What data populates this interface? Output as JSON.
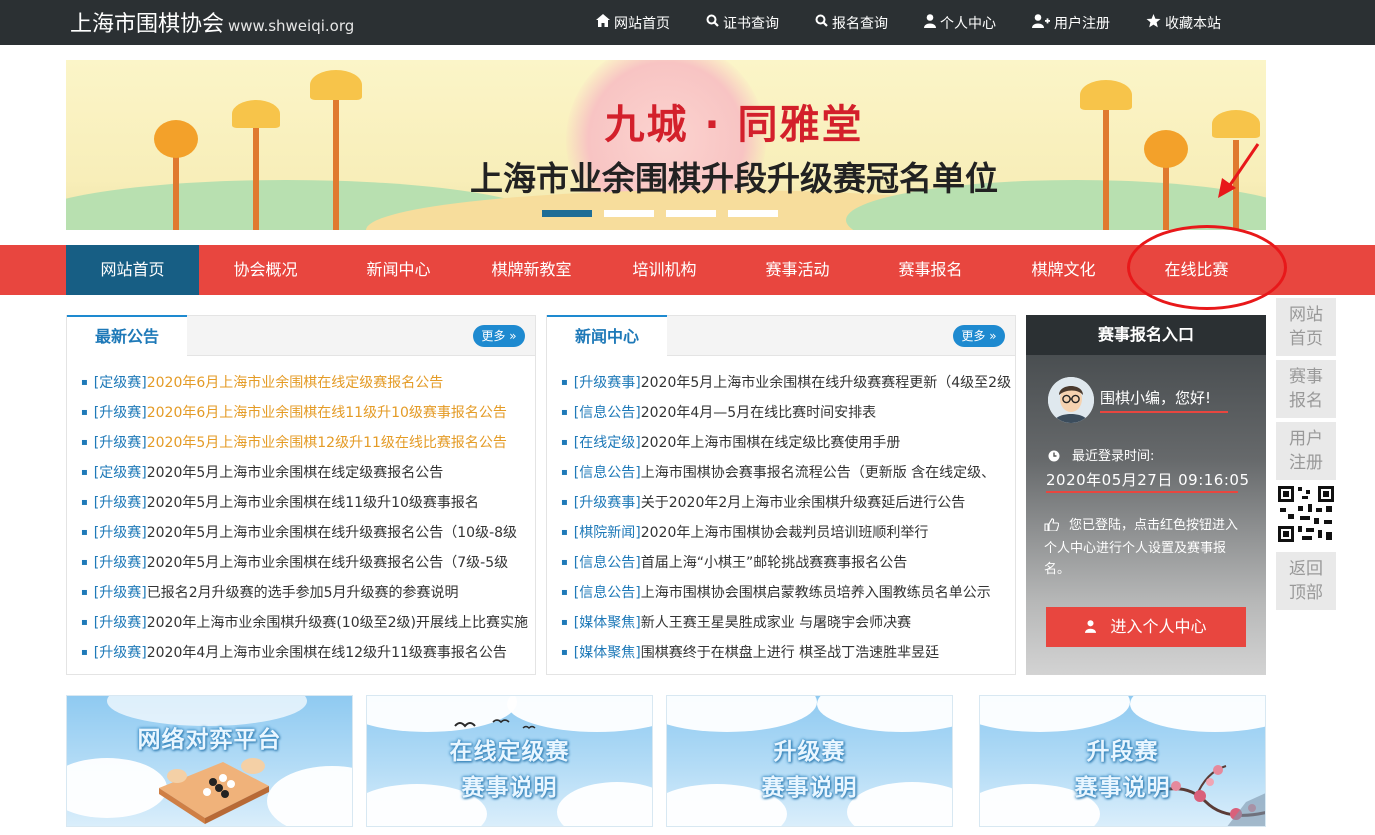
{
  "header": {
    "site_name": "上海市围棋协会",
    "site_domain": "www.shweiqi.org",
    "links": [
      {
        "label": "网站首页",
        "icon": "home-icon"
      },
      {
        "label": "证书查询",
        "icon": "search-icon"
      },
      {
        "label": "报名查询",
        "icon": "search-icon"
      },
      {
        "label": "个人中心",
        "icon": "user-icon"
      },
      {
        "label": "用户注册",
        "icon": "user-plus-icon"
      },
      {
        "label": "收藏本站",
        "icon": "star-icon"
      }
    ]
  },
  "banner": {
    "title": "九城 · 同雅堂",
    "subtitle": "上海市业余围棋升段升级赛冠名单位",
    "active_slide": 1,
    "slide_count": 4
  },
  "nav": {
    "items": [
      "网站首页",
      "协会概况",
      "新闻中心",
      "棋牌新教室",
      "培训机构",
      "赛事活动",
      "赛事报名",
      "棋牌文化",
      "在线比赛"
    ],
    "active_index": 0
  },
  "side": {
    "buttons": [
      "网站首页",
      "赛事报名",
      "用户注册",
      "返回顶部"
    ]
  },
  "announcements": {
    "tab": "最新公告",
    "more": "更多 »",
    "items": [
      {
        "cat": "[定级赛]",
        "title": "2020年6月上海市业余围棋在线定级赛报名公告",
        "highlight": true
      },
      {
        "cat": "[升级赛]",
        "title": "2020年6月上海市业余围棋在线11级升10级赛事报名公告",
        "highlight": true
      },
      {
        "cat": "[升级赛]",
        "title": "2020年5月上海市业余围棋12级升11级在线比赛报名公告",
        "highlight": true
      },
      {
        "cat": "[定级赛]",
        "title": "2020年5月上海市业余围棋在线定级赛报名公告",
        "highlight": false
      },
      {
        "cat": "[升级赛]",
        "title": "2020年5月上海市业余围棋在线11级升10级赛事报名",
        "highlight": false
      },
      {
        "cat": "[升级赛]",
        "title": "2020年5月上海市业余围棋在线升级赛报名公告（10级-8级",
        "highlight": false
      },
      {
        "cat": "[升级赛]",
        "title": "2020年5月上海市业余围棋在线升级赛报名公告（7级-5级",
        "highlight": false
      },
      {
        "cat": "[升级赛]",
        "title": "已报名2月升级赛的选手参加5月升级赛的参赛说明",
        "highlight": false
      },
      {
        "cat": "[升级赛]",
        "title": "2020年上海市业余围棋升级赛(10级至2级)开展线上比赛实施",
        "highlight": false
      },
      {
        "cat": "[升级赛]",
        "title": "2020年4月上海市业余围棋在线12级升11级赛事报名公告",
        "highlight": false
      }
    ]
  },
  "news": {
    "tab": "新闻中心",
    "more": "更多 »",
    "items": [
      {
        "cat": "[升级赛事]",
        "title": "2020年5月上海市业余围棋在线升级赛赛程更新（4级至2级"
      },
      {
        "cat": "[信息公告]",
        "title": "2020年4月—5月在线比赛时间安排表"
      },
      {
        "cat": "[在线定级]",
        "title": "2020年上海市围棋在线定级比赛使用手册"
      },
      {
        "cat": "[信息公告]",
        "title": "上海市围棋协会赛事报名流程公告（更新版 含在线定级、"
      },
      {
        "cat": "[升级赛事]",
        "title": "关于2020年2月上海市业余围棋升级赛延后进行公告"
      },
      {
        "cat": "[棋院新闻]",
        "title": "2020年上海市围棋协会裁判员培训班顺利举行"
      },
      {
        "cat": "[信息公告]",
        "title": "首届上海“小棋王”邮轮挑战赛赛事报名公告"
      },
      {
        "cat": "[信息公告]",
        "title": "上海市围棋协会围棋启蒙教练员培养入围教练员名单公示"
      },
      {
        "cat": "[媒体聚焦]",
        "title": "新人王赛王星昊胜成家业 与屠晓宇会师决赛"
      },
      {
        "cat": "[媒体聚焦]",
        "title": "围棋赛终于在棋盘上进行 棋圣战丁浩速胜芈昱廷"
      }
    ]
  },
  "login": {
    "title": "赛事报名入口",
    "greeting": "围棋小编，您好!",
    "last_login_label": "最近登录时间:",
    "last_login_time": "2020年05月27日 09:16:05",
    "tip": "您已登陆，点击红色按钮进入个人中心进行个人设置及赛事报名。",
    "button": "进入个人中心"
  },
  "cards": [
    {
      "lines": [
        "网络对弈平台"
      ]
    },
    {
      "lines": [
        "在线定级赛",
        "赛事说明"
      ]
    },
    {
      "lines": [
        "升级赛",
        "赛事说明"
      ]
    },
    {
      "lines": [
        "升段赛",
        "赛事说明"
      ]
    }
  ],
  "colors": {
    "topbar": "#2b3033",
    "nav_red": "#e8463f",
    "nav_active": "#175e84",
    "link_blue": "#1e79b8",
    "highlight_orange": "#e49b26"
  }
}
